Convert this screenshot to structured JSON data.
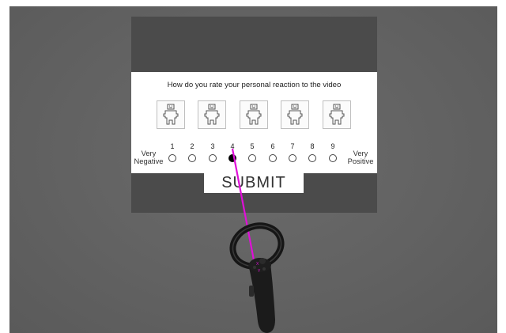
{
  "survey": {
    "question": "How do you rate your personal reaction to the video",
    "scale": [
      "1",
      "2",
      "3",
      "4",
      "5",
      "6",
      "7",
      "8",
      "9"
    ],
    "selected_value": 4,
    "low_anchor_line1": "Very",
    "low_anchor_line2": "Negative",
    "high_anchor_line1": "Very",
    "high_anchor_line2": "Positive",
    "submit_label": "SUBMIT"
  },
  "pictogram": "self-assessment-manikin-icon",
  "controller": "vr-controller-icon",
  "colors": {
    "pointer_ray": "#e010d8",
    "panel": "#4b4b4b",
    "background": "#626262"
  }
}
